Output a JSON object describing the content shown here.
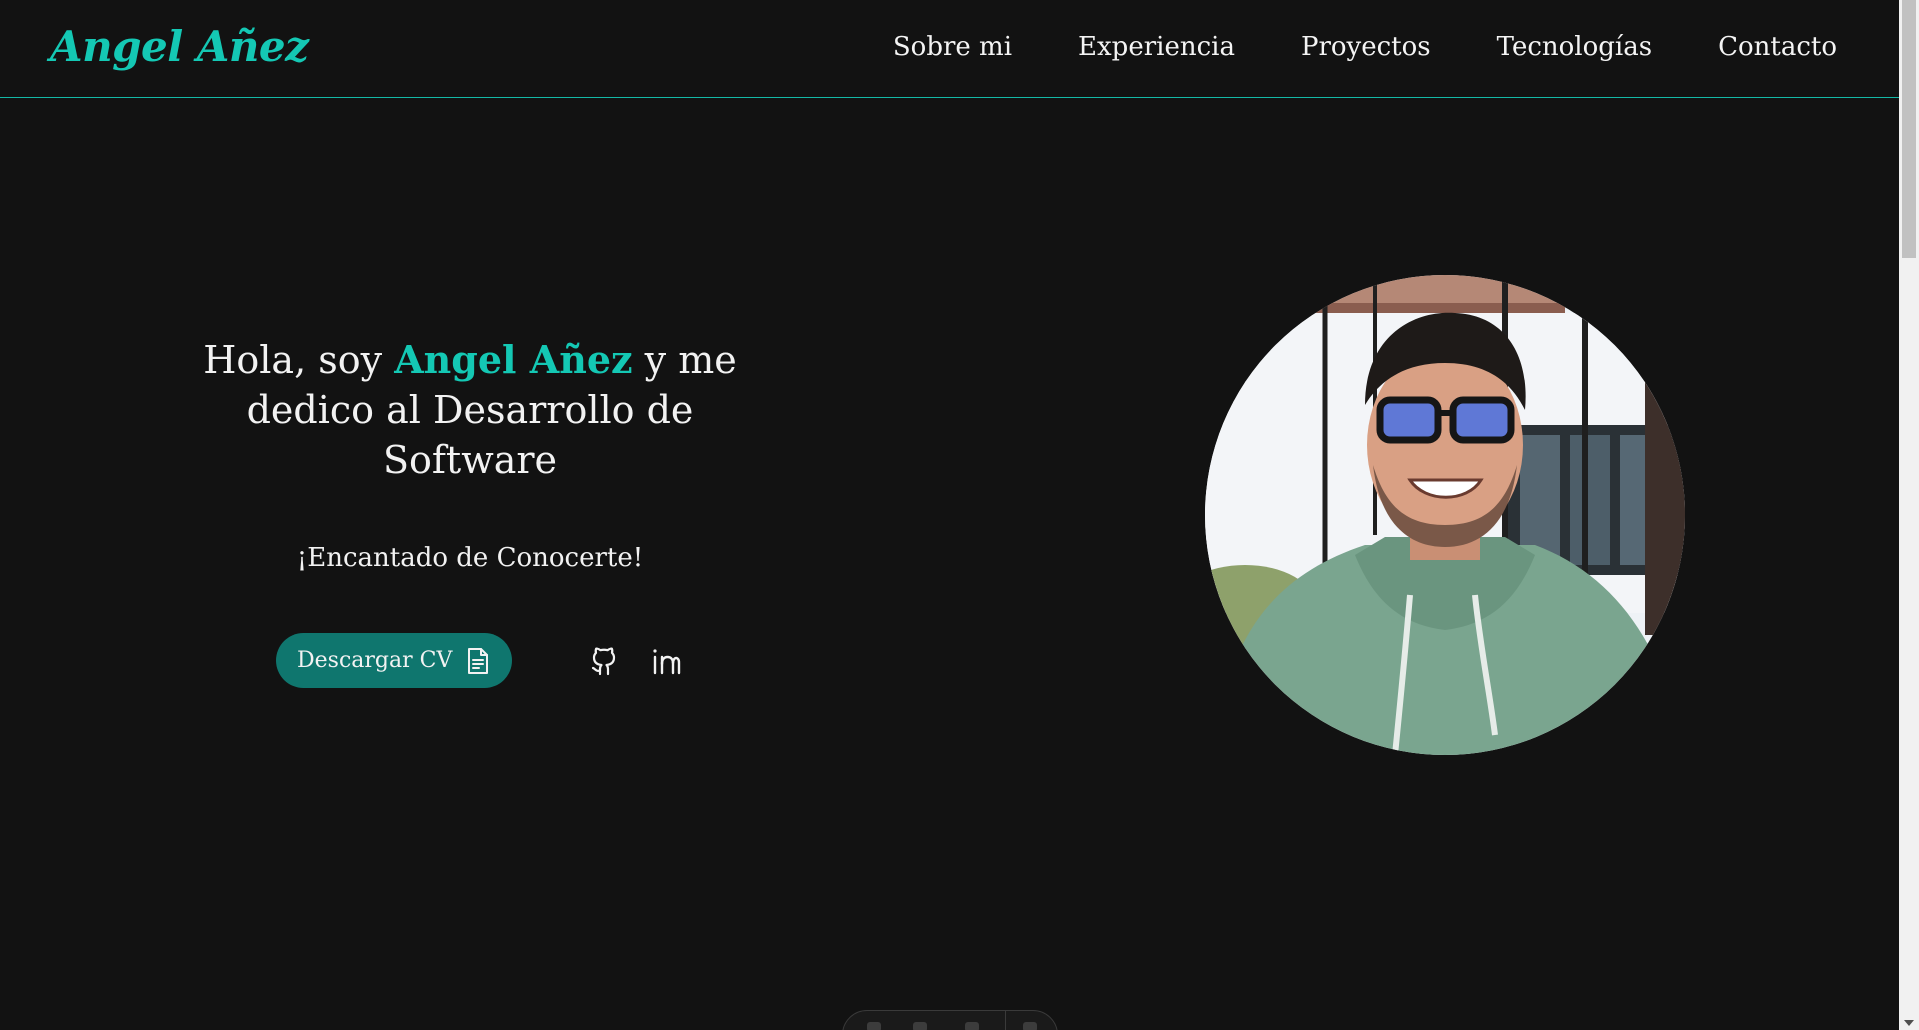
{
  "header": {
    "logo": "Angel Añez",
    "nav": [
      {
        "label": "Sobre mi"
      },
      {
        "label": "Experiencia"
      },
      {
        "label": "Proyectos"
      },
      {
        "label": "Tecnologías"
      },
      {
        "label": "Contacto"
      }
    ]
  },
  "hero": {
    "title_prefix": "Hola, soy ",
    "title_name": "Angel Añez",
    "title_suffix": " y me dedico al Desarrollo de Software",
    "subtitle": "¡Encantado de Conocerte!",
    "cv_button_label": "Descargar CV",
    "social": [
      {
        "icon": "github-icon"
      },
      {
        "icon": "linkedin-icon"
      }
    ]
  },
  "colors": {
    "background": "#121212",
    "accent": "#14c8b4",
    "button": "#0f766e",
    "header_border": "#14b8a6"
  }
}
